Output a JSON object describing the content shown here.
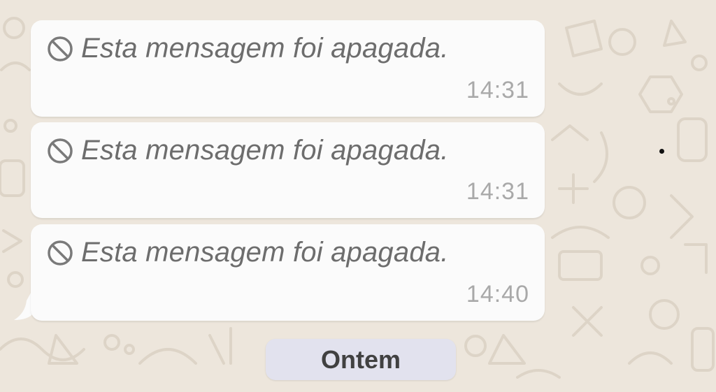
{
  "chat": {
    "messages": [
      {
        "icon": "ban-icon",
        "text": "Esta mensagem foi apagada.",
        "time": "14:31"
      },
      {
        "icon": "ban-icon",
        "text": "Esta mensagem foi apagada.",
        "time": "14:31"
      },
      {
        "icon": "ban-icon",
        "text": "Esta mensagem foi apagada.",
        "time": "14:40"
      }
    ],
    "date_separator": "Ontem"
  },
  "colors": {
    "wallpaper": "#ede6dc",
    "bubble": "#fbfbfb",
    "deleted_text": "#6d6d6d",
    "timestamp": "#a9a9a9",
    "date_pill": "#e2e2ee",
    "date_text": "#414141"
  }
}
